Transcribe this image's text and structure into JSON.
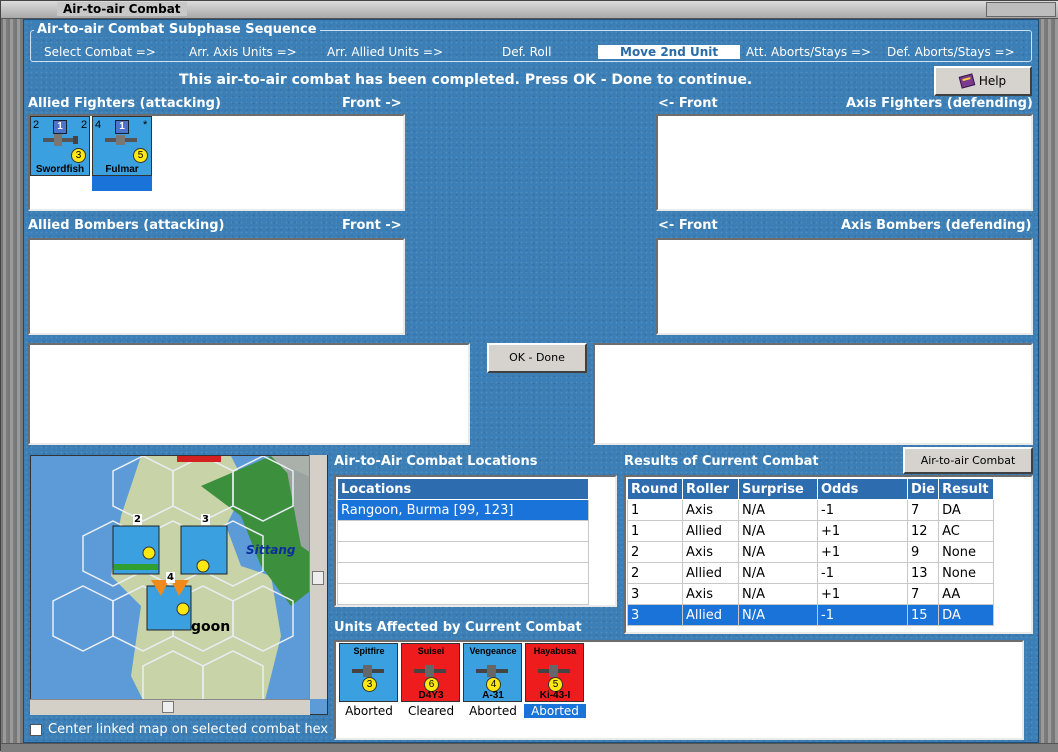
{
  "window": {
    "title": "Air-to-air Combat"
  },
  "sequence": {
    "legend": "Air-to-air Combat Subphase Sequence",
    "steps": [
      "Select Combat =>",
      "Arr. Axis Units =>",
      "Arr. Allied Units =>",
      "Def. Roll",
      "Move 2nd Unit",
      "Att. Aborts/Stays =>",
      "Def. Aborts/Stays =>"
    ],
    "active_index": 4
  },
  "status_message": "This air-to-air combat has been completed.  Press OK - Done to continue.",
  "help_label": "Help",
  "labels": {
    "allied_fighters": "Allied Fighters (attacking)",
    "front_right": "Front ->",
    "front_left": "<- Front",
    "axis_fighters": "Axis Fighters (defending)",
    "allied_bombers": "Allied Bombers (attacking)",
    "axis_bombers": "Axis Bombers (defending)"
  },
  "ok_done_label": "OK - Done",
  "allied_fighter_units": [
    {
      "name": "Swordfish",
      "att": "2",
      "range": "2",
      "def": "3",
      "badge": "1",
      "selected": false
    },
    {
      "name": "Fulmar",
      "att": "4",
      "range": "*",
      "def": "5",
      "badge": "1",
      "selected": true
    }
  ],
  "map": {
    "place_labels": [
      "Sittang",
      "goon"
    ],
    "stack_counts": [
      "2",
      "3",
      "4"
    ]
  },
  "locations": {
    "title": "Air-to-Air Combat Locations",
    "header": "Locations",
    "rows": [
      "Rangoon, Burma [99, 123]"
    ],
    "selected_index": 0
  },
  "results": {
    "title": "Results of Current Combat",
    "chart_button": "Air-to-air Combat Chart",
    "columns": [
      "Round",
      "Roller",
      "Surprise",
      "Odds",
      "Die",
      "Result"
    ],
    "rows": [
      [
        "1",
        "Axis",
        "N/A",
        "-1",
        "7",
        "DA"
      ],
      [
        "1",
        "Allied",
        "N/A",
        "+1",
        "12",
        "AC"
      ],
      [
        "2",
        "Axis",
        "N/A",
        "+1",
        "9",
        "None"
      ],
      [
        "2",
        "Allied",
        "N/A",
        "-1",
        "13",
        "None"
      ],
      [
        "3",
        "Axis",
        "N/A",
        "+1",
        "7",
        "AA"
      ],
      [
        "3",
        "Allied",
        "N/A",
        "-1",
        "15",
        "DA"
      ]
    ],
    "selected_index": 5
  },
  "affected": {
    "title": "Units Affected by Current Combat",
    "units": [
      {
        "name": "Spitfire",
        "status": "Aborted",
        "value": "3",
        "color": "#3aa0e0",
        "selected": false
      },
      {
        "name": "D4Y3",
        "top": "Suisei",
        "status": "Cleared",
        "value": "6",
        "color": "#ee1c1c",
        "selected": false
      },
      {
        "name": "A-31",
        "top": "Vengeance",
        "status": "Aborted",
        "value": "4",
        "color": "#3aa0e0",
        "selected": false
      },
      {
        "name": "Ki-43-I",
        "top": "Hayabusa",
        "status": "Aborted",
        "value": "5",
        "color": "#ee1c1c",
        "selected": true
      }
    ]
  },
  "center_map_label": "Center linked map on selected combat hex",
  "colors": {
    "background": "#3b7fb6",
    "selection": "#1a73d9",
    "header": "#2e6cb0"
  }
}
